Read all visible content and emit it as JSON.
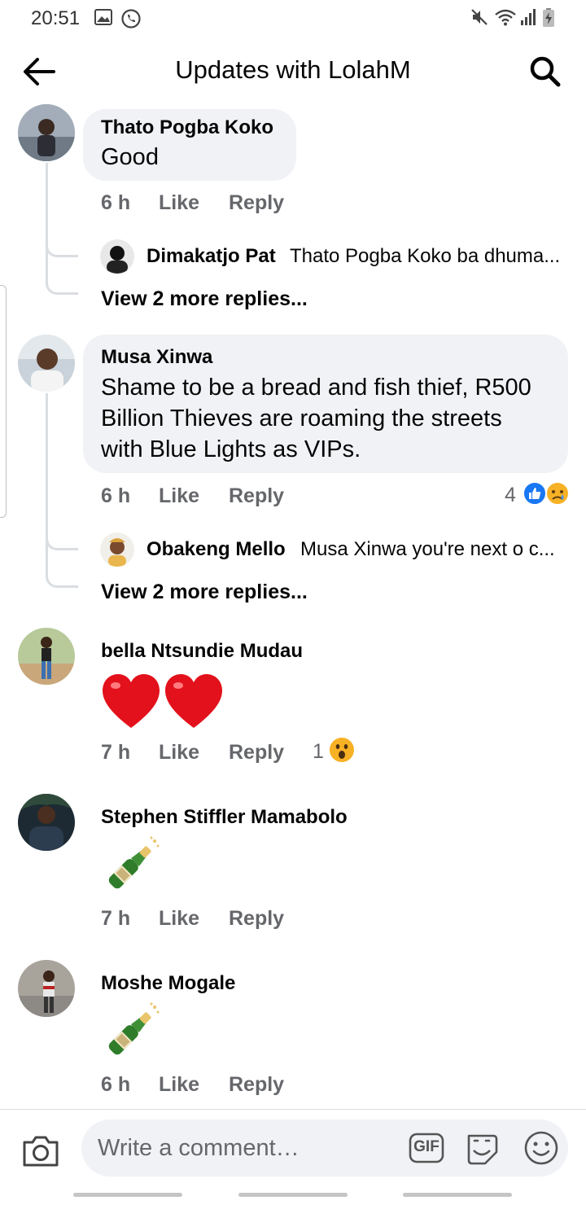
{
  "status_bar": {
    "time": "20:51",
    "left_icons": [
      "gallery-icon",
      "whatsapp-icon"
    ],
    "right_icons": [
      "mute-icon",
      "wifi-icon",
      "signal-icon",
      "battery-charging-icon"
    ]
  },
  "header": {
    "title": "Updates with LolahM",
    "back_icon": "arrow-left-icon",
    "search_icon": "search-icon"
  },
  "labels": {
    "like": "Like",
    "reply": "Reply"
  },
  "comments": [
    {
      "author": "Thato Pogba Koko",
      "text": "Good",
      "time": "6 h",
      "reply_preview": {
        "author": "Dimakatjo Pat",
        "snippet": "Thato Pogba Koko ba dhuma..."
      },
      "view_more": "View 2 more replies..."
    },
    {
      "author": "Musa Xinwa",
      "text_lines": [
        "Shame to be a bread and fish thief, R500",
        "Billion Thieves are roaming the streets",
        "with Blue Lights as VIPs."
      ],
      "time": "6 h",
      "reaction_count": "4",
      "reactions": [
        "like-reaction-icon",
        "sad-reaction-icon"
      ],
      "reply_preview": {
        "author": "Obakeng Mello",
        "snippet": "Musa Xinwa you're next o c..."
      },
      "view_more": "View 2 more replies..."
    },
    {
      "author": "bella Ntsundie Mudau",
      "emoji": "❤❤",
      "time": "7 h",
      "reaction_count": "1",
      "reactions": [
        "wow-reaction-icon"
      ]
    },
    {
      "author": "Stephen Stiffler Mamabolo",
      "emoji": "🍾",
      "time": "7 h"
    },
    {
      "author": "Moshe Mogale",
      "emoji": "🍾",
      "time": "6 h"
    }
  ],
  "composer": {
    "placeholder": "Write a comment…",
    "camera_icon": "camera-icon",
    "gif_label": "GIF",
    "sticker_icon": "sticker-icon",
    "emoji_icon": "smiley-icon"
  },
  "colors": {
    "bubble": "#f0f2f5",
    "meta_text": "#65676b",
    "like_blue": "#1877f2"
  }
}
